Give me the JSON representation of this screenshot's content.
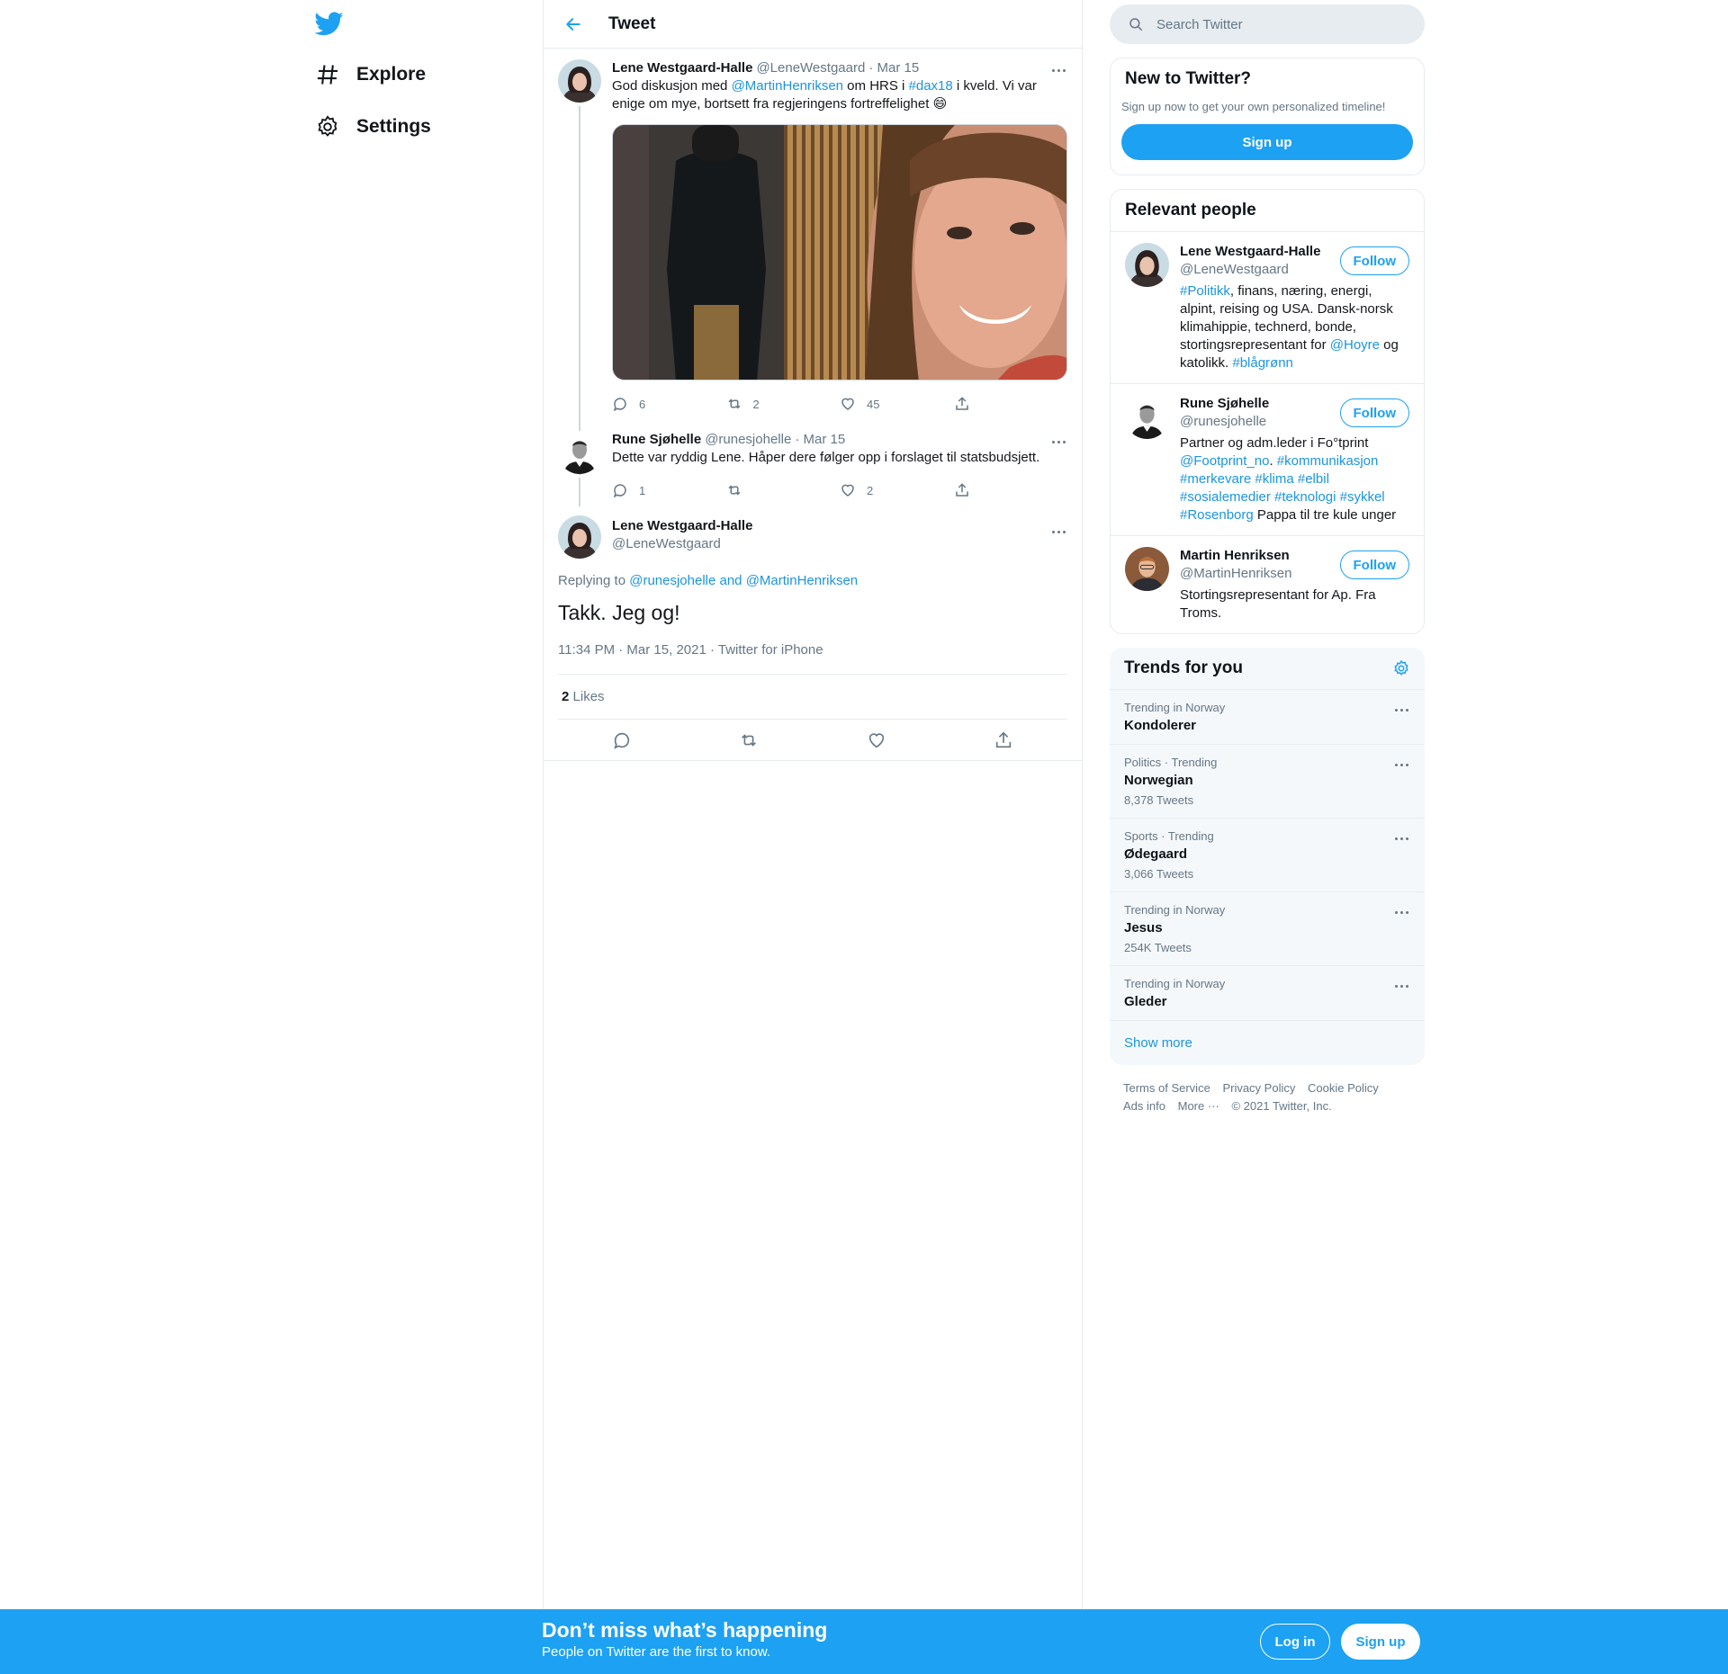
{
  "nav": {
    "logo": "twitter-bird-icon",
    "items": [
      {
        "label": "Explore",
        "icon": "hashtag-icon"
      },
      {
        "label": "Settings",
        "icon": "gear-icon"
      }
    ]
  },
  "header": {
    "title": "Tweet"
  },
  "thread": [
    {
      "name": "Lene Westgaard-Halle",
      "handle": "@LeneWestgaard",
      "date": "· Mar 15",
      "text_parts": [
        "God diskusjon med ",
        "@MartinHenriksen",
        " om HRS i ",
        "#dax18",
        " i kveld. Vi var enige om mye, bortsett fra regjeringens fortreffelighet 😄"
      ],
      "replies": "6",
      "retweets": "2",
      "likes": "45"
    },
    {
      "name": "Rune Sjøhelle",
      "handle": "@runesjohelle",
      "date": "· Mar 15",
      "text": "Dette var ryddig Lene. Håper dere følger opp i forslaget til statsbudsjett.",
      "replies": "1",
      "retweets": "",
      "likes": "2"
    }
  ],
  "main_tweet": {
    "name": "Lene Westgaard-Halle",
    "handle": "@LeneWestgaard",
    "replying_prefix": "Replying to ",
    "replying_to": "@runesjohelle and @MartinHenriksen",
    "text": "Takk. Jeg og!",
    "timestamp": "11:34 PM · Mar 15, 2021 · Twitter for iPhone",
    "likes_count": "2",
    "likes_label": "Likes"
  },
  "search": {
    "placeholder": "Search Twitter"
  },
  "new_to_twitter": {
    "title": "New to Twitter?",
    "subtitle": "Sign up now to get your own personalized timeline!",
    "button": "Sign up"
  },
  "relevant_people": {
    "title": "Relevant people",
    "follow_label": "Follow",
    "people": [
      {
        "name": "Lene Westgaard-Halle",
        "handle": "@LeneWestgaard",
        "bio_parts": [
          [
            "#Politikk",
            true
          ],
          [
            ", finans, næring, energi, alpint, reising og USA. Dansk-norsk klimahippie, technerd, bonde, stortingsrepresentant for ",
            false
          ],
          [
            "@Hoyre",
            true
          ],
          [
            " og katolikk. ",
            false
          ],
          [
            "#blågrønn",
            true
          ]
        ]
      },
      {
        "name": "Rune Sjøhelle",
        "handle": "@runesjohelle",
        "bio_parts": [
          [
            "Partner og adm.leder i Fo°tprint ",
            false
          ],
          [
            "@Footprint_no",
            true
          ],
          [
            ". ",
            false
          ],
          [
            "#kommunikasjon #merkevare #klima #elbil #sosialemedier #teknologi #sykkel #Rosenborg",
            true
          ],
          [
            " Pappa til tre kule unger",
            false
          ]
        ]
      },
      {
        "name": "Martin Henriksen",
        "handle": "@MartinHenriksen",
        "bio_parts": [
          [
            "Stortingsrepresentant for Ap. Fra Troms.",
            false
          ]
        ]
      }
    ]
  },
  "trends": {
    "title": "Trends for you",
    "items": [
      {
        "meta": "Trending in Norway",
        "name": "Kondolerer",
        "count": ""
      },
      {
        "meta": "Politics · Trending",
        "name": "Norwegian",
        "count": "8,378 Tweets"
      },
      {
        "meta": "Sports · Trending",
        "name": "Ødegaard",
        "count": "3,066 Tweets"
      },
      {
        "meta": "Trending in Norway",
        "name": "Jesus",
        "count": "254K Tweets"
      },
      {
        "meta": "Trending in Norway",
        "name": "Gleder",
        "count": ""
      }
    ],
    "show_more": "Show more"
  },
  "footer": {
    "links": [
      "Terms of Service",
      "Privacy Policy",
      "Cookie Policy",
      "Ads info",
      "More ···"
    ],
    "copyright": "© 2021 Twitter, Inc."
  },
  "bottom_bar": {
    "title": "Don’t miss what’s happening",
    "subtitle": "People on Twitter are the first to know.",
    "login": "Log in",
    "signup": "Sign up"
  },
  "colors": {
    "accent": "#1da1f2",
    "link": "#1b95e0",
    "muted": "#657786",
    "border": "#e6ecf0"
  }
}
